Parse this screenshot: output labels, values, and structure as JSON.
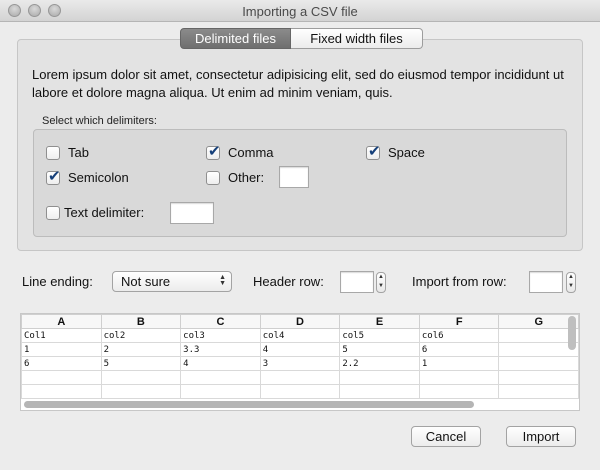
{
  "window": {
    "title": "Importing a CSV file"
  },
  "tabs": {
    "delimited": "Delimited files",
    "fixed": "Fixed width files"
  },
  "intro_text": "Lorem ipsum dolor sit amet, consectetur adipisicing elit, sed do eiusmod tempor incididunt ut labore et dolore magna aliqua. Ut enim ad minim veniam, quis.",
  "delimiters": {
    "caption": "Select which delimiters:",
    "tab": {
      "label": "Tab",
      "checked": false
    },
    "comma": {
      "label": "Comma",
      "checked": true
    },
    "space": {
      "label": "Space",
      "checked": true
    },
    "semicolon": {
      "label": "Semicolon",
      "checked": true
    },
    "other": {
      "label": "Other:",
      "checked": false,
      "value": ""
    },
    "text_delimiter": {
      "label": "Text delimiter:",
      "checked": false,
      "value": ""
    }
  },
  "options": {
    "line_ending_label": "Line ending:",
    "line_ending_value": "Not sure",
    "header_row_label": "Header row:",
    "header_row_value": "",
    "import_from_label": "Import from row:",
    "import_from_value": ""
  },
  "preview": {
    "columns": [
      "A",
      "B",
      "C",
      "D",
      "E",
      "F",
      "G"
    ],
    "rows": [
      [
        "Col1",
        "col2",
        "col3",
        "col4",
        "col5",
        "col6",
        ""
      ],
      [
        "1",
        "2",
        "3.3",
        "4",
        "5",
        "6",
        ""
      ],
      [
        "6",
        "5",
        "4",
        "3",
        "2.2",
        "1",
        ""
      ],
      [
        "",
        "",
        "",
        "",
        "",
        "",
        ""
      ],
      [
        "",
        "",
        "",
        "",
        "",
        "",
        ""
      ]
    ]
  },
  "buttons": {
    "cancel": "Cancel",
    "import": "Import"
  }
}
